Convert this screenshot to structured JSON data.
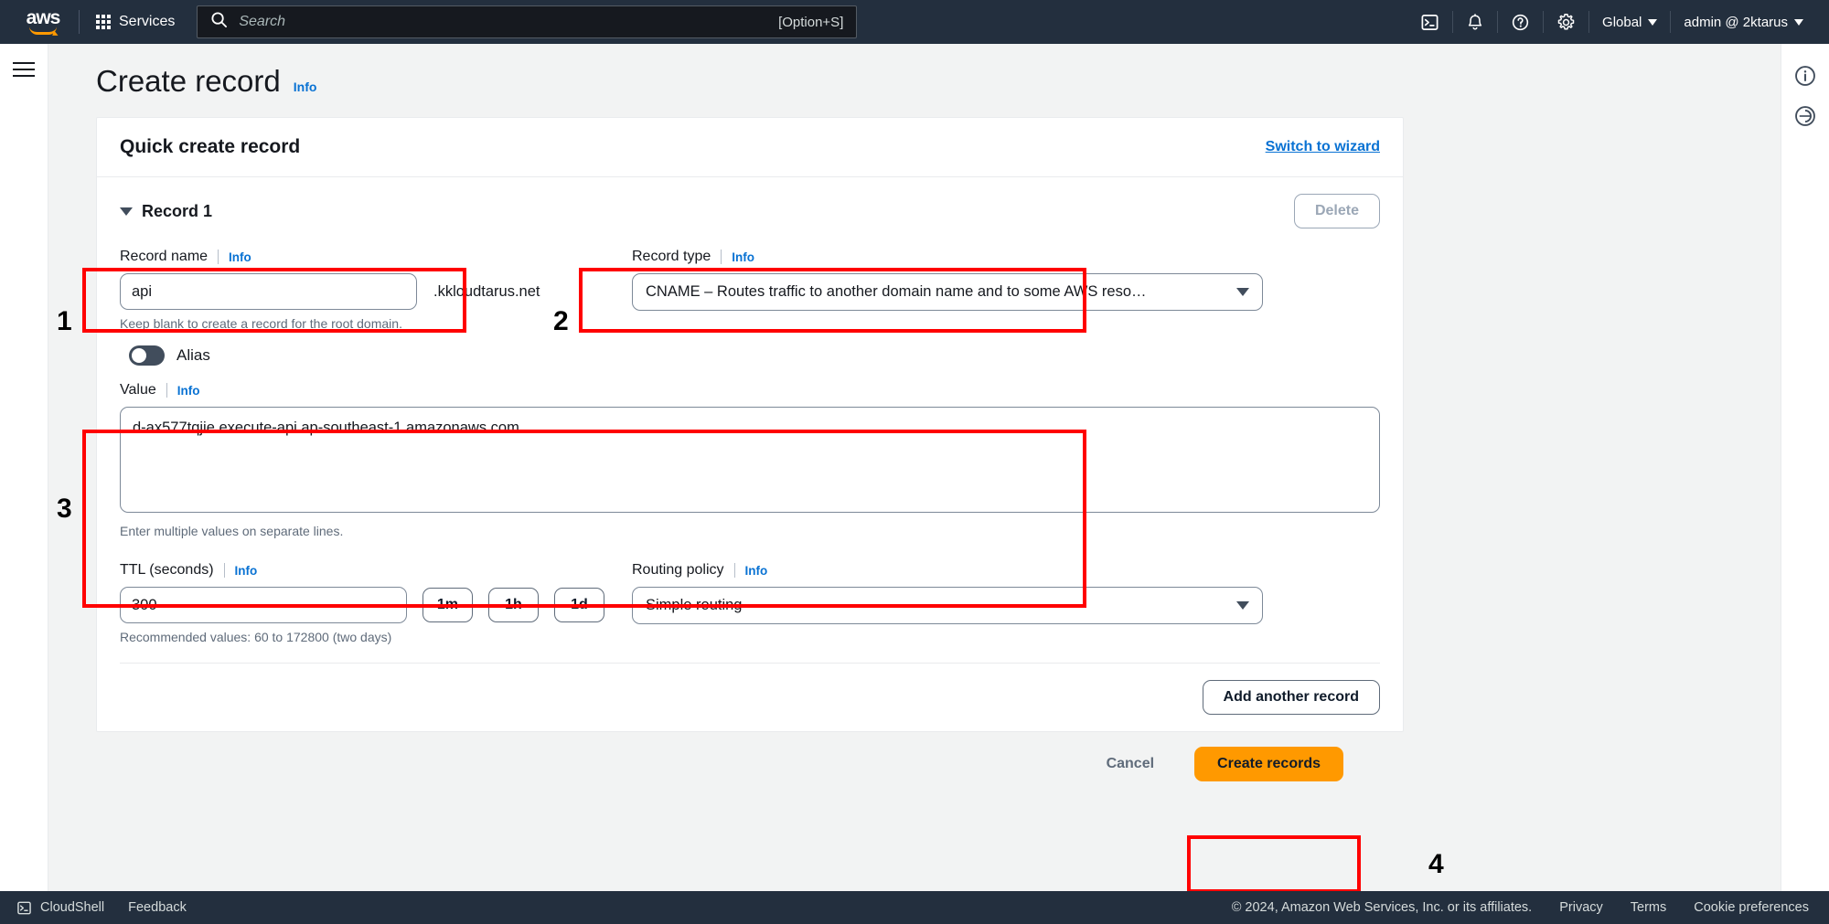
{
  "topnav": {
    "logo_alt": "aws",
    "services_label": "Services",
    "search_placeholder": "Search",
    "search_value": "",
    "search_shortcut": "[Option+S]",
    "cloudshell_icon": "cloudshell-icon",
    "notifications_icon": "bell-icon",
    "help_icon": "question-circle-icon",
    "settings_icon": "gear-icon",
    "region_label": "Global",
    "account_label": "admin @ 2ktarus"
  },
  "page": {
    "title": "Create record",
    "info_label": "Info"
  },
  "panel": {
    "title": "Quick create record",
    "switch_link": "Switch to wizard"
  },
  "record": {
    "heading": "Record 1",
    "delete_label": "Delete",
    "record_name": {
      "label": "Record name",
      "info": "Info",
      "value": "api",
      "placeholder": "",
      "suffix": ".kkloudtarus.net",
      "hint": "Keep blank to create a record for the root domain."
    },
    "record_type": {
      "label": "Record type",
      "info": "Info",
      "value": "CNAME – Routes traffic to another domain name and to some AWS reso…"
    },
    "alias": {
      "label": "Alias",
      "enabled": false
    },
    "value_field": {
      "label": "Value",
      "info": "Info",
      "value": "d-ax577tqjie.execute-api.ap-southeast-1.amazonaws.com",
      "hint": "Enter multiple values on separate lines."
    },
    "ttl": {
      "label": "TTL (seconds)",
      "info": "Info",
      "value": "300",
      "presets": [
        "1m",
        "1h",
        "1d"
      ],
      "hint": "Recommended values: 60 to 172800 (two days)"
    },
    "routing_policy": {
      "label": "Routing policy",
      "info": "Info",
      "value": "Simple routing"
    },
    "add_another_label": "Add another record"
  },
  "actions": {
    "cancel_label": "Cancel",
    "create_label": "Create records"
  },
  "annotations": {
    "step1": "1",
    "step2": "2",
    "step3": "3",
    "step4": "4",
    "color": "#ff0000"
  },
  "footer": {
    "cloudshell_label": "CloudShell",
    "feedback_label": "Feedback",
    "copyright": "© 2024, Amazon Web Services, Inc. or its affiliates.",
    "privacy_label": "Privacy",
    "terms_label": "Terms",
    "cookie_label": "Cookie preferences"
  },
  "rightrail": {
    "info_icon": "info-circle-icon",
    "shortcuts_icon": "shortcuts-circle-icon"
  },
  "theme": {
    "nav_bg": "#232f3e",
    "accent_orange": "#ff9900",
    "link_blue": "#0972d3"
  }
}
